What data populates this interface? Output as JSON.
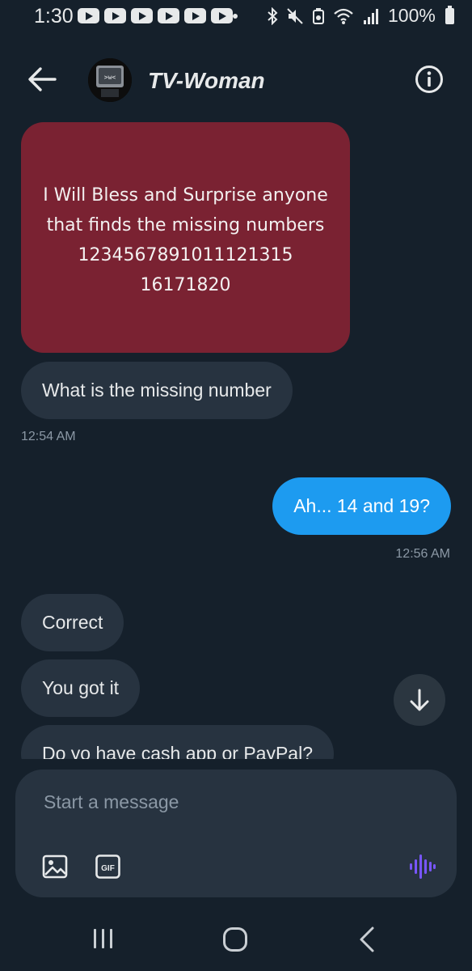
{
  "status_bar": {
    "time": "1:30",
    "battery": "100%",
    "notification_icons": [
      "youtube-icon",
      "youtube-icon",
      "youtube-icon",
      "youtube-icon",
      "youtube-icon",
      "youtube-icon"
    ],
    "system_icons": [
      "bluetooth-icon",
      "mute-icon",
      "recycle-icon",
      "wifi-icon",
      "signal-icon",
      "battery-icon"
    ]
  },
  "header": {
    "contact_name": "TV-Woman",
    "avatar_text": ">w<"
  },
  "messages": {
    "image_text": [
      "I Will Bless and Surprise anyone",
      "that finds the missing numbers",
      "1234567891011121315",
      "16171820"
    ],
    "in_1": "What is the missing number",
    "ts_1": "12:54 AM",
    "out_1": "Ah... 14 and 19?",
    "ts_2": "12:56 AM",
    "in_2": "Correct",
    "in_3": "You got it",
    "in_4": "Do yo have cash app or PayPal?"
  },
  "composer": {
    "placeholder": "Start a message",
    "gif_label": "GIF"
  },
  "colors": {
    "background": "#15202b",
    "incoming_bubble": "#273340",
    "outgoing_bubble": "#1d9bf0",
    "image_bg": "#7a2232",
    "voice_accent": "#7856ff"
  }
}
